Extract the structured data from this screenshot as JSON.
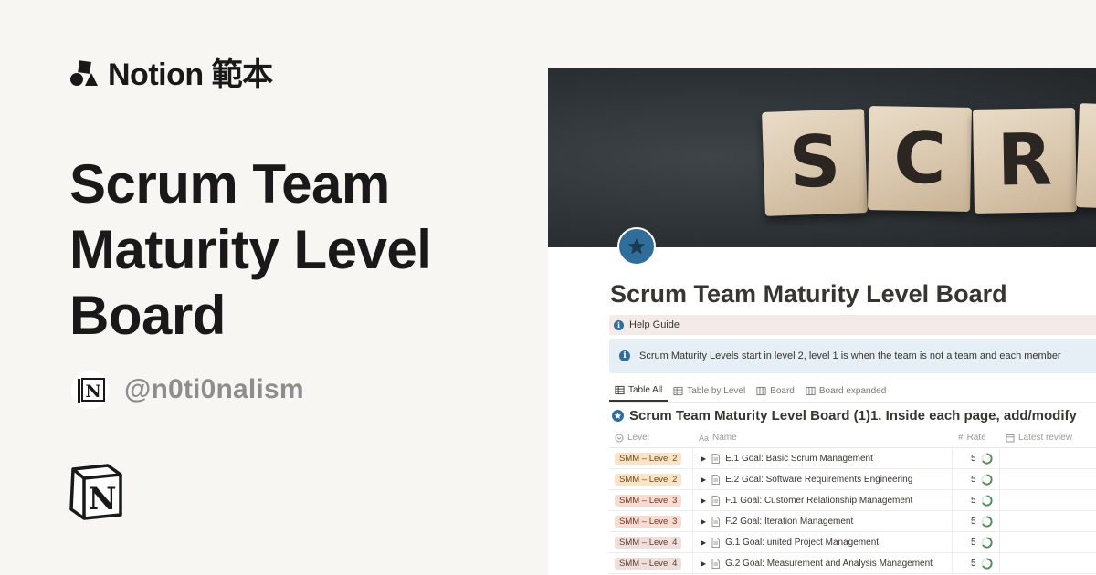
{
  "brand": {
    "text": "Notion 範本"
  },
  "heading": "Scrum Team Maturity Level Board",
  "author": {
    "handle": "@n0ti0nalism"
  },
  "preview": {
    "cover_letters": [
      "S",
      "C",
      "R",
      "U"
    ],
    "title": "Scrum Team Maturity Level Board",
    "help_guide": "Help Guide",
    "callout": "Scrum Maturity Levels start in level 2, level 1 is when the team is not a team and each member",
    "tabs": [
      {
        "label": "Table All",
        "icon": "table-icon",
        "active": true
      },
      {
        "label": "Table by Level",
        "icon": "table-icon",
        "active": false
      },
      {
        "label": "Board",
        "icon": "board-icon",
        "active": false
      },
      {
        "label": "Board expanded",
        "icon": "board-icon",
        "active": false
      }
    ],
    "db_title": "Scrum Team Maturity Level Board (1)1. Inside each page, add/modify",
    "columns": {
      "level": "Level",
      "name": "Name",
      "rate": "Rate",
      "review": "Latest review"
    },
    "rows": [
      {
        "level": "SMM – Level 2",
        "level_num": 2,
        "name": "E.1 Goal: Basic Scrum Management",
        "rate": "5"
      },
      {
        "level": "SMM – Level 2",
        "level_num": 2,
        "name": "E.2 Goal: Software Requirements Engineering",
        "rate": "5"
      },
      {
        "level": "SMM – Level 3",
        "level_num": 3,
        "name": "F.1 Goal: Customer Relationship Management",
        "rate": "5"
      },
      {
        "level": "SMM – Level 3",
        "level_num": 3,
        "name": "F.2 Goal: Iteration Management",
        "rate": "5"
      },
      {
        "level": "SMM – Level 4",
        "level_num": 4,
        "name": "G.1 Goal: united Project Management",
        "rate": "5"
      },
      {
        "level": "SMM – Level 4",
        "level_num": 4,
        "name": "G.2 Goal: Measurement and Analysis Management",
        "rate": "5"
      }
    ]
  },
  "colors": {
    "accent_blue": "#2f6d9a",
    "callout_bg": "#e6eff6",
    "help_bg": "#f4ebe9"
  }
}
